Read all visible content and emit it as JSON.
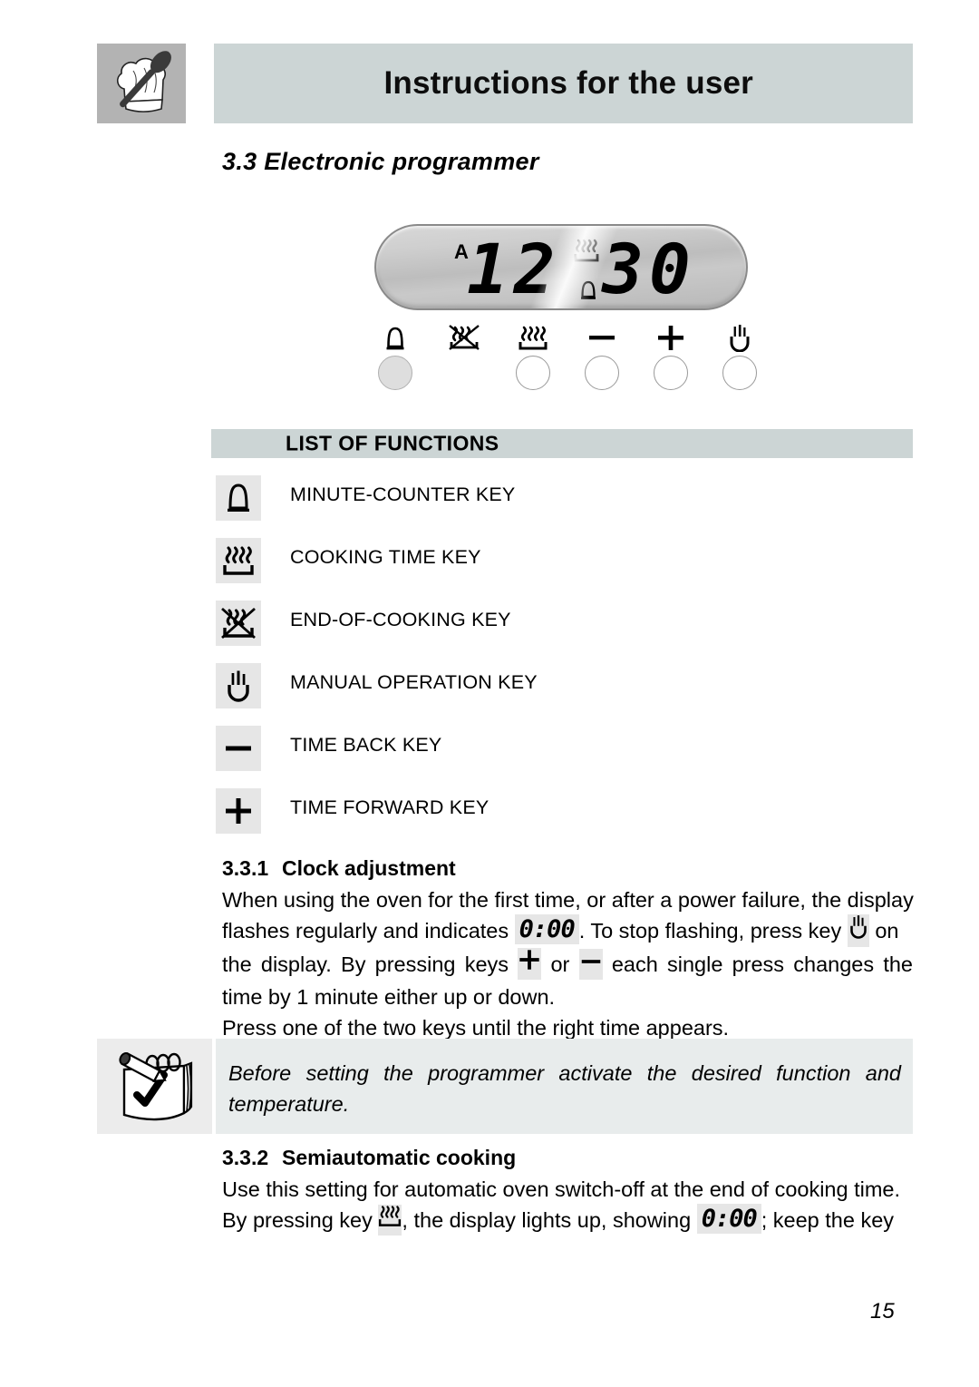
{
  "header": {
    "title": "Instructions for the user",
    "icon": "chef-hat-spoon-icon"
  },
  "section": {
    "number": "3.3",
    "title": "3.3 Electronic programmer"
  },
  "display": {
    "auto_indicator": "A",
    "hours": "12",
    "separator": ":",
    "minutes": "30",
    "time": "12:30",
    "icons": [
      "cooking-time-icon",
      "minute-counter-bell-icon"
    ]
  },
  "button_row": [
    {
      "icon": "minute-counter-bell-icon",
      "has_circle": true,
      "filled": true
    },
    {
      "icon": "end-of-cooking-icon",
      "has_circle": false,
      "filled": false
    },
    {
      "icon": "cooking-time-icon",
      "has_circle": true,
      "filled": false
    },
    {
      "icon": "time-back-minus-icon",
      "has_circle": true,
      "filled": false
    },
    {
      "icon": "time-forward-plus-icon",
      "has_circle": true,
      "filled": false
    },
    {
      "icon": "manual-operation-hand-icon",
      "has_circle": true,
      "filled": false
    }
  ],
  "list_of_functions": {
    "heading": "LIST OF FUNCTIONS",
    "items": [
      {
        "icon": "minute-counter-bell-icon",
        "label": "MINUTE-COUNTER KEY"
      },
      {
        "icon": "cooking-time-icon",
        "label": "COOKING TIME KEY"
      },
      {
        "icon": "end-of-cooking-icon",
        "label": "END-OF-COOKING KEY"
      },
      {
        "icon": "manual-operation-hand-icon",
        "label": "MANUAL OPERATION KEY"
      },
      {
        "icon": "time-back-minus-icon",
        "label": "TIME BACK KEY"
      },
      {
        "icon": "time-forward-plus-icon",
        "label": "TIME FORWARD KEY"
      }
    ]
  },
  "clock_adjustment": {
    "number": "3.3.1",
    "title": "Clock adjustment",
    "line1": "When using the oven for the first time, or after a power failure, the display",
    "line2_a": "flashes regularly and indicates",
    "line2_lcd": "0:00",
    "line2_b": ". To stop flashing, press key",
    "line2_c": "on",
    "line3_a": "the display. By pressing keys",
    "line3_b": "or",
    "line3_c": "each single press changes the",
    "line4": "time by 1 minute either up or down.",
    "line5": "Press one of the two keys until the right time appears."
  },
  "note": {
    "icon": "notepad-pencil-check-icon",
    "line1": "Before setting the programmer activate the desired function and",
    "line2": "temperature."
  },
  "semiautomatic_cooking": {
    "number": "3.3.2",
    "title": "Semiautomatic cooking",
    "line1": "Use this setting for automatic oven switch-off at the end of cooking time.",
    "line2_a": "By pressing key",
    "line2_b": ", the display lights up, showing",
    "line2_lcd": "0:00",
    "line2_c": "; keep the key"
  },
  "footer": {
    "page_number": "15"
  },
  "colors": {
    "header_bar": "#ccd5d5",
    "header_icon_bg": "#b3b3b3",
    "icon_tile_bg": "#e6e6e6",
    "note_bg": "#e8ecec",
    "note_icon_bg": "#ececec",
    "text": "#000000"
  }
}
